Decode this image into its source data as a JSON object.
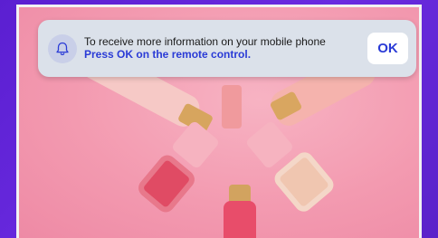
{
  "notification": {
    "icon": "bell-icon",
    "message": "To receive more information on your mobile phone",
    "instruction": "Press OK on the remote control.",
    "ok_label": "OK"
  },
  "colors": {
    "background_purple": "#5b1fd1",
    "accent_blue": "#2a3bd6",
    "notification_bg": "#dbe1ea"
  }
}
